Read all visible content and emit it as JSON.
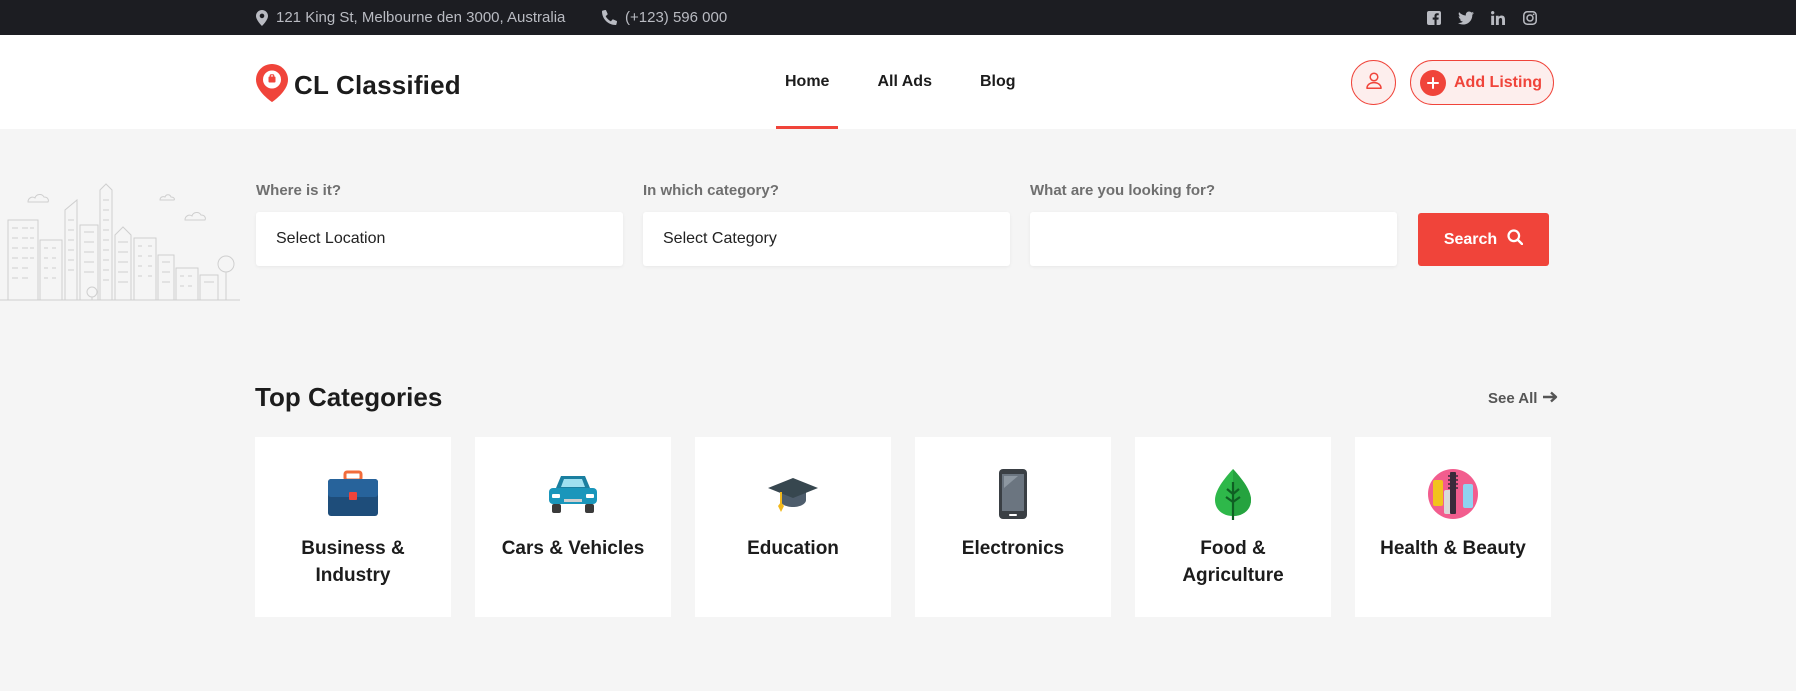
{
  "topbar": {
    "address": "121 King St, Melbourne den 3000, Australia",
    "phone": "(+123) 596 000",
    "socials": [
      "facebook-icon",
      "twitter-icon",
      "linkedin-icon",
      "instagram-icon"
    ]
  },
  "header": {
    "logo_text": "CL Classified",
    "nav": [
      {
        "label": "Home",
        "active": true
      },
      {
        "label": "All Ads",
        "active": false
      },
      {
        "label": "Blog",
        "active": false
      }
    ],
    "add_listing_label": "Add Listing"
  },
  "search": {
    "location_label": "Where is it?",
    "location_value": "Select Location",
    "category_label": "In which category?",
    "category_value": "Select Category",
    "keyword_label": "What are you looking for?",
    "keyword_value": "",
    "search_label": "Search"
  },
  "categories": {
    "title": "Top Categories",
    "see_all_label": "See All",
    "items": [
      {
        "name": "Business & Industry",
        "icon": "briefcase-icon"
      },
      {
        "name": "Cars & Vehicles",
        "icon": "car-icon"
      },
      {
        "name": "Education",
        "icon": "graduation-cap-icon"
      },
      {
        "name": "Electronics",
        "icon": "smartphone-icon"
      },
      {
        "name": "Food & Agriculture",
        "icon": "leaf-icon"
      },
      {
        "name": "Health & Beauty",
        "icon": "cosmetics-icon"
      }
    ]
  },
  "colors": {
    "accent": "#f0443a",
    "topbar_bg": "#1c1d22",
    "page_bg": "#f5f5f5"
  }
}
